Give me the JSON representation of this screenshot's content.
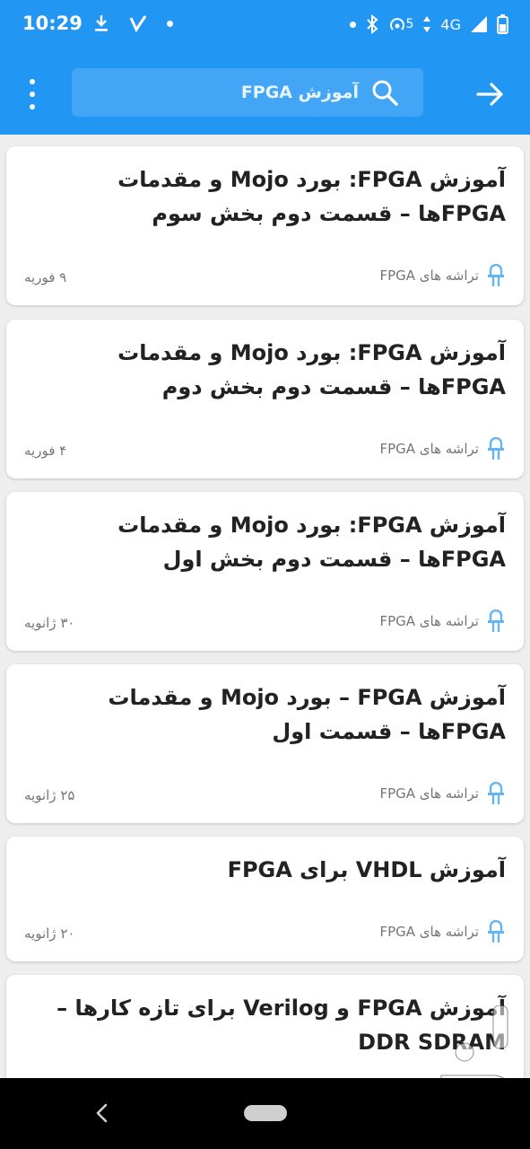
{
  "status": {
    "time": "10:29",
    "network": "4G",
    "hotspot_count": "5"
  },
  "search": {
    "text": "آموزش FPGA"
  },
  "posts": [
    {
      "title": "آموزش FPGA: بورد Mojo و مقدمات FPGAها – قسمت دوم بخش سوم",
      "category": "تراشه های FPGA",
      "date": "۹ فوریه"
    },
    {
      "title": "آموزش FPGA: بورد Mojo و مقدمات FPGAها – قسمت دوم بخش دوم",
      "category": "تراشه های FPGA",
      "date": "۴ فوریه"
    },
    {
      "title": "آموزش FPGA: بورد Mojo و مقدمات FPGAها – قسمت دوم بخش اول",
      "category": "تراشه های FPGA",
      "date": "۳۰ ژانویه"
    },
    {
      "title": "آموزش FPGA – بورد Mojo و مقدمات FPGAها – قسمت اول",
      "category": "تراشه های FPGA",
      "date": "۲۵ ژانویه"
    },
    {
      "title": "آموزش VHDL برای FPGA",
      "category": "تراشه های FPGA",
      "date": "۲۰ ژانویه"
    },
    {
      "title": "آموزش FPGA و Verilog برای تازه کارها – DDR SDRAM",
      "category": "",
      "date": ""
    }
  ],
  "colors": {
    "primary": "#2196f3",
    "category_icon": "#64b5f6"
  }
}
